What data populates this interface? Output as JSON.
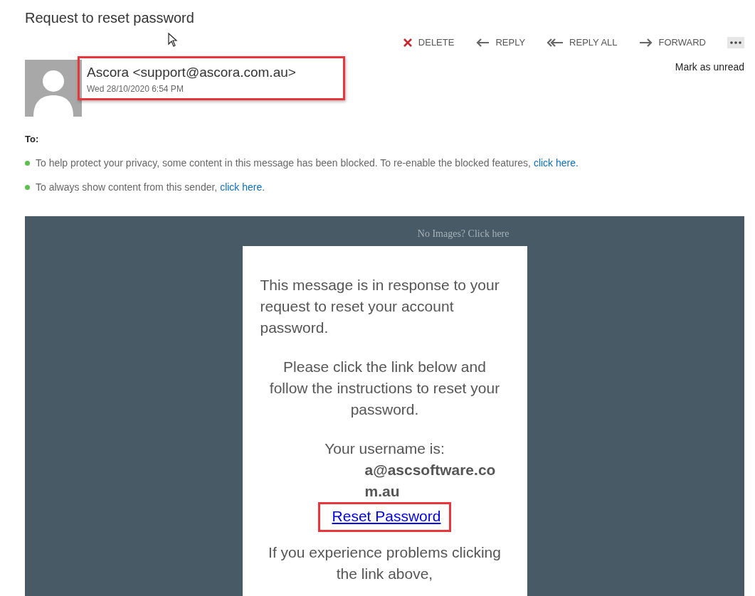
{
  "title": "Request to reset password",
  "toolbar": [
    {
      "kind": "delete",
      "label": "DELETE"
    },
    {
      "kind": "reply",
      "label": "REPLY"
    },
    {
      "kind": "reply_all",
      "label": "REPLY ALL"
    },
    {
      "kind": "forward",
      "label": "FORWARD"
    },
    {
      "kind": "more"
    }
  ],
  "sender": {
    "name": "Ascora <support@ascora.com.au>",
    "date": "Wed 28/10/2020 6:54 PM",
    "highlighted": true
  },
  "mark_unread": "Mark as unread",
  "to_label": "To:",
  "notices": [
    {
      "text": "To help protect your privacy, some content in this message has been blocked. To re-enable the blocked features, ",
      "link": "click here."
    },
    {
      "text": "To always show content from this sender, ",
      "link": "click here."
    }
  ],
  "body": {
    "no_images": "No Images? Click here",
    "paragraphs": [
      {
        "text": "This message is in response to your request to reset your account password.",
        "kind": "plain"
      },
      {
        "text": "Please click the link below and follow the instructions to reset your password.",
        "kind": "centered"
      }
    ],
    "username_label": "Your username is:",
    "username": "a@ascsoftware.com.au",
    "reset_link": {
      "label": "Reset Password",
      "highlighted": true
    },
    "closing": "If you experience problems clicking the link above,"
  }
}
